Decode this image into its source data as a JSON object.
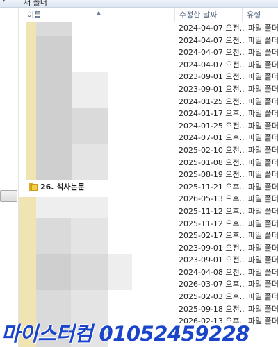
{
  "toolbar": {
    "new_folder_label": "새 폴더"
  },
  "columns": {
    "name": "이름",
    "date_modified": "수정한 날짜",
    "type": "유형"
  },
  "rows": [
    {
      "date": "2024-04-07 오전...",
      "type": "파일 폴더"
    },
    {
      "date": "2024-04-07 오전...",
      "type": "파일 폴더"
    },
    {
      "date": "2024-04-07 오전...",
      "type": "파일 폴더"
    },
    {
      "date": "2024-04-07 오전...",
      "type": "파일 폴더"
    },
    {
      "date": "2023-09-01 오전...",
      "type": "파일 폴더"
    },
    {
      "date": "2023-09-01 오전...",
      "type": "파일 폴더"
    },
    {
      "date": "2024-01-25 오전...",
      "type": "파일 폴더"
    },
    {
      "date": "2024-01-17 오후...",
      "type": "파일 폴더"
    },
    {
      "date": "2024-01-25 오전...",
      "type": "파일 폴더"
    },
    {
      "date": "2024-07-01 오후...",
      "type": "파일 폴더"
    },
    {
      "date": "2025-02-10 오전...",
      "type": "파일 폴더"
    },
    {
      "date": "2025-01-08 오전...",
      "type": "파일 폴더"
    },
    {
      "date": "2025-08-19 오전...",
      "type": "파일 폴더"
    },
    {
      "name": "26. 석사논문",
      "date": "2025-11-21 오후...",
      "type": "파일 폴더"
    },
    {
      "date": "2026-05-13 오후...",
      "type": "파일 폴더"
    },
    {
      "date": "2025-11-12 오후...",
      "type": "파일 폴더"
    },
    {
      "date": "2025-11-12 오후...",
      "type": "파일 폴더"
    },
    {
      "date": "2025-02-17 오후...",
      "type": "파일 폴더"
    },
    {
      "date": "2023-09-01 오전...",
      "type": "파일 폴더"
    },
    {
      "date": "2023-09-01 오전...",
      "type": "파일 폴더"
    },
    {
      "date": "2024-04-08 오전...",
      "type": "파일 폴더"
    },
    {
      "date": "2026-03-07 오후...",
      "type": "파일 폴더"
    },
    {
      "date": "2025-02-03 오후...",
      "type": "파일 폴더"
    },
    {
      "date": "2025-09-18 오전...",
      "type": "파일 폴더"
    },
    {
      "date": "2026-02-13 오후...",
      "type": "파일 폴더"
    }
  ],
  "watermark": {
    "text": "마이스터컴 01052459228",
    "color": "#1a44c9"
  },
  "icons": {
    "folder": "folder-icon",
    "sort": "sort-up-icon"
  }
}
